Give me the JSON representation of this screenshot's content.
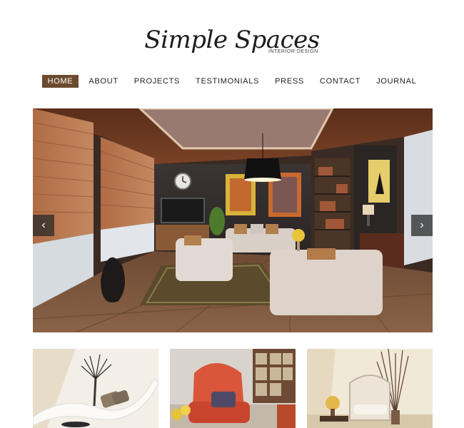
{
  "logo": {
    "title": "Simple Spaces",
    "subtitle": "INTERIOR DESIGN"
  },
  "nav": {
    "items": [
      {
        "label": "HOME",
        "active": true
      },
      {
        "label": "ABOUT",
        "active": false
      },
      {
        "label": "PROJECTS",
        "active": false
      },
      {
        "label": "TESTIMONIALS",
        "active": false
      },
      {
        "label": "PRESS",
        "active": false
      },
      {
        "label": "CONTACT",
        "active": false
      },
      {
        "label": "JOURNAL",
        "active": false
      }
    ]
  },
  "slider": {
    "prev_icon": "‹",
    "next_icon": "›"
  },
  "colors": {
    "accent": "#6b4a2e"
  }
}
